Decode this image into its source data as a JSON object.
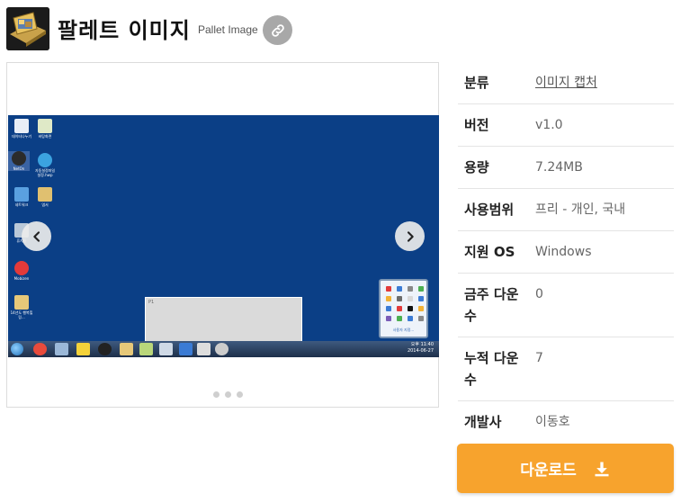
{
  "app": {
    "title": "팔레트 이미지",
    "subtitle": "Pallet Image",
    "icon": "app-icon",
    "link_icon": "link-icon"
  },
  "carousel": {
    "prev_icon": "chevron-left-icon",
    "next_icon": "chevron-right-icon",
    "slide_count": 3,
    "active_slide": 1,
    "screenshot": {
      "window_label": "P1",
      "clock_time": "오후 11:40",
      "clock_date": "2014-06-27",
      "tray_link": "사용자 지정...",
      "desktop_icons": [
        "데이터나누기",
        "바탕화면",
        "NetOn",
        "자동설정파일 설정.hwp",
        "네트워크",
        "엽서",
        "휴지통",
        "",
        "Mobizen",
        "",
        "14년도 행복힐링..."
      ]
    }
  },
  "info": {
    "rows": [
      {
        "label": "분류",
        "value": "이미지 캡처",
        "is_link": true
      },
      {
        "label": "버전",
        "value": "v1.0"
      },
      {
        "label": "용량",
        "value": "7.24MB"
      },
      {
        "label": "사용범위",
        "value": "프리 - 개인, 국내"
      },
      {
        "label": "지원 OS",
        "value": "Windows"
      },
      {
        "label": "금주 다운수",
        "value": "0"
      },
      {
        "label": "누적 다운수",
        "value": "7"
      },
      {
        "label": "개발사",
        "value": "이동호"
      }
    ]
  },
  "download": {
    "label": "다운로드",
    "icon": "download-icon",
    "color": "#f7a32d"
  }
}
